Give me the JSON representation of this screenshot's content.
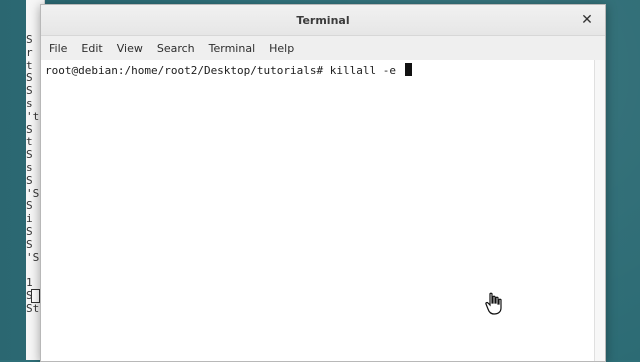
{
  "desktop": {
    "background_left_window_lines": [
      "S",
      "r",
      "t",
      "S",
      "S",
      "s",
      "'t",
      "S",
      "t",
      "S",
      "s",
      "S",
      "'S",
      "S",
      "i",
      "S",
      "S",
      "'S",
      "",
      "1",
      "Se",
      "St"
    ]
  },
  "terminal": {
    "title": "Terminal",
    "menu": [
      "File",
      "Edit",
      "View",
      "Search",
      "Terminal",
      "Help"
    ],
    "prompt": "root@debian:/home/root2/Desktop/tutorials#",
    "command": "killall -e",
    "icons": {
      "close": "close-icon",
      "pointer": "hand-pointer-icon"
    }
  }
}
